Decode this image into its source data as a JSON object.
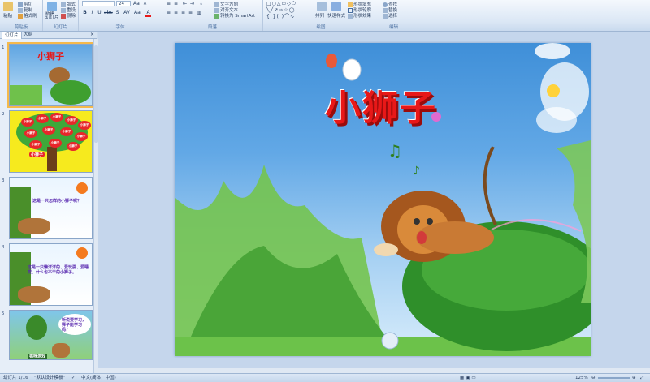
{
  "ribbon": {
    "clipboard": {
      "label": "剪贴板",
      "paste": "粘贴",
      "cut": "剪切",
      "copy": "复制",
      "format_painter": "格式刷"
    },
    "slides": {
      "label": "幻灯片",
      "new_slide": "新建\n幻灯片",
      "layout": "版式",
      "reset": "重设",
      "delete": "删除"
    },
    "font": {
      "label": "字体",
      "size": "24",
      "bold": "B",
      "italic": "I",
      "underline": "U",
      "strike": "S",
      "abc": "abc",
      "shadow": "S",
      "spacing": "AV",
      "case": "Aa",
      "color": "A"
    },
    "paragraph": {
      "label": "段落",
      "text_direction": "文字方向",
      "align_text": "对齐文本",
      "smartart": "转换为 SmartArt"
    },
    "drawing": {
      "label": "绘图",
      "arrange": "排列",
      "quick_styles": "快速样式",
      "shape_fill": "形状填充",
      "shape_outline": "形状轮廓",
      "shape_effects": "形状效果"
    },
    "editing": {
      "label": "编辑",
      "find": "查找",
      "replace": "替换",
      "select": "选择"
    }
  },
  "panel_tabs": [
    "幻灯片",
    "大纲"
  ],
  "thumbnails": [
    {
      "num": "1",
      "title": "小狮子"
    },
    {
      "num": "2",
      "apples": [
        "小狮子",
        "小狮子",
        "小狮子",
        "小狮子",
        "小狮子",
        "小狮子",
        "小狮子",
        "小狮子",
        "小狮子",
        "小狮子",
        "小狮子",
        "小狮子"
      ],
      "trunk_label": "小狮子"
    },
    {
      "num": "3",
      "text": "这是一只怎样的小狮子呢？"
    },
    {
      "num": "4",
      "text": "这是一只懒洋洋的、爱玩耍、爱睡觉、什么也不干的小狮子。"
    },
    {
      "num": "5",
      "bubble": "听说要学习，狮子能学习吗？",
      "sign": "猫咪游戏"
    }
  ],
  "slide": {
    "title": "小狮子"
  },
  "status": {
    "slide_no": "幻灯片 1/16",
    "theme": "\"默认设计模板\"",
    "lang": "中文(简体，中国)",
    "zoom": "125%"
  },
  "colors": {
    "title_red": "#e81818",
    "ribbon_bg": "#dbe7f5",
    "selection": "#f5b94b"
  }
}
